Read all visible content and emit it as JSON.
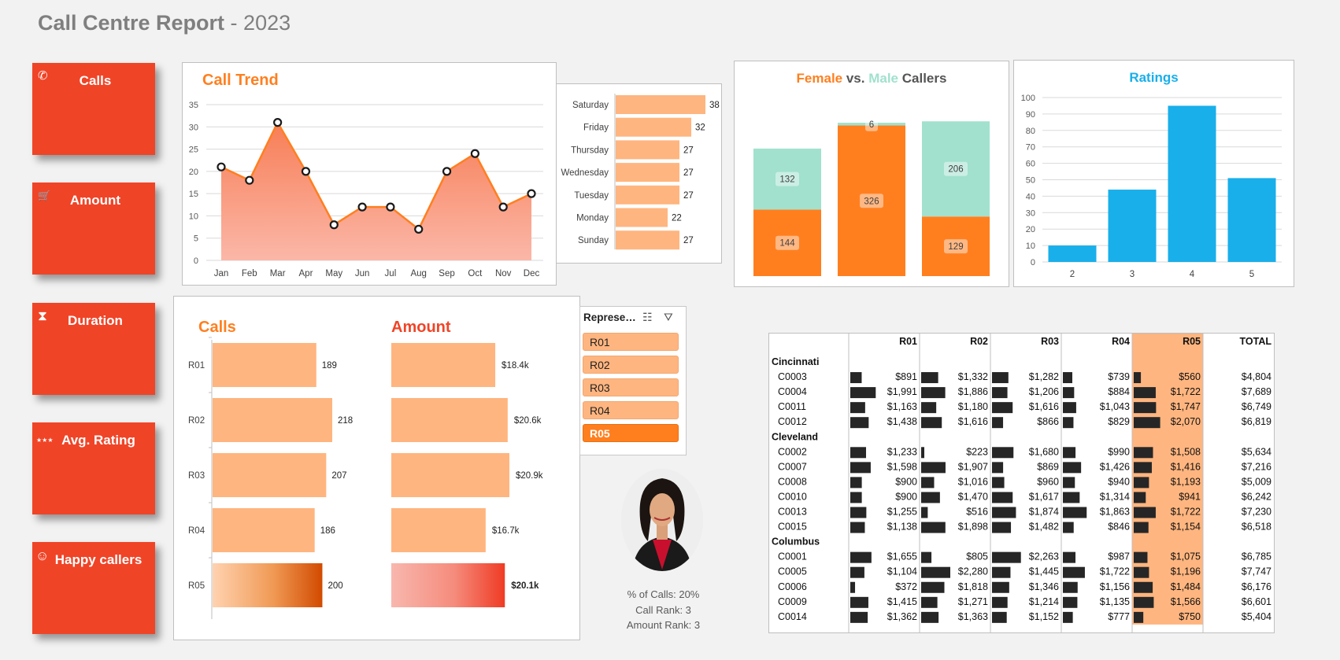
{
  "title": {
    "main": "Call Centre Report",
    "sep": " - ",
    "year": "2023"
  },
  "colors": {
    "kpi": "#f04427",
    "orange": "#ff7f1f",
    "mint": "#a1e1ce",
    "blue": "#19afea",
    "light_orange": "#ffb57f",
    "title_grey": "#7f7f7f"
  },
  "kpis": [
    {
      "label": "Calls",
      "icon": "phone-icon",
      "glyph": "✆"
    },
    {
      "label": "Amount",
      "icon": "cart-icon",
      "glyph": "🛒"
    },
    {
      "label": "Duration",
      "icon": "hourglass-icon",
      "glyph": "⧗"
    },
    {
      "label": "Avg. Rating",
      "icon": "stars-icon",
      "glyph": "★★★"
    },
    {
      "label": "Happy callers",
      "icon": "smiley-icon",
      "glyph": "☺"
    }
  ],
  "call_trend": {
    "title": "Call Trend"
  },
  "gender": {
    "title_female": "Female",
    "title_vs": " vs. ",
    "title_male": "Male",
    "title_callers": " Callers"
  },
  "ratings": {
    "title": "Ratings"
  },
  "rep_panel": {
    "calls_title": "Calls",
    "amount_title": "Amount"
  },
  "slicer": {
    "header": "Represe…",
    "multiselect_icon": "multi-select-icon",
    "clear_filter_icon": "clear-filter-icon",
    "items": [
      {
        "label": "R01",
        "selected": false
      },
      {
        "label": "R02",
        "selected": false
      },
      {
        "label": "R03",
        "selected": false
      },
      {
        "label": "R04",
        "selected": false
      },
      {
        "label": "R05",
        "selected": true
      }
    ]
  },
  "rep_stats": {
    "pct_calls": "% of Calls: 20%",
    "call_rank": "Call Rank: 3",
    "amount_rank": "Amount Rank: 3"
  },
  "chart_data": [
    {
      "type": "area",
      "title": "Call Trend",
      "x": [
        "Jan",
        "Feb",
        "Mar",
        "Apr",
        "May",
        "Jun",
        "Jul",
        "Aug",
        "Sep",
        "Oct",
        "Nov",
        "Dec"
      ],
      "y": [
        21,
        18,
        31,
        20,
        8,
        12,
        12,
        7,
        20,
        24,
        12,
        15
      ],
      "ylim": [
        0,
        35
      ],
      "yticks": [
        "0",
        "5",
        "10",
        "15",
        "20",
        "25",
        "30",
        "35"
      ],
      "grid": true
    },
    {
      "type": "bar",
      "orientation": "horizontal",
      "categories": [
        "Saturday",
        "Friday",
        "Thursday",
        "Wednesday",
        "Tuesday",
        "Monday",
        "Sunday"
      ],
      "values": [
        38,
        32,
        27,
        27,
        27,
        22,
        27
      ],
      "data_labels": true
    },
    {
      "type": "bar",
      "stacked": true,
      "title": "Female vs. Male Callers",
      "series": [
        {
          "name": "Female",
          "values": [
            144,
            326,
            129
          ]
        },
        {
          "name": "Male",
          "values": [
            132,
            6,
            206
          ]
        }
      ],
      "data_labels": true
    },
    {
      "type": "bar",
      "title": "Ratings",
      "categories": [
        "2",
        "3",
        "4",
        "5"
      ],
      "values": [
        10,
        44,
        95,
        51
      ],
      "ylim": [
        0,
        100
      ],
      "yticks": [
        "0",
        "10",
        "20",
        "30",
        "40",
        "50",
        "60",
        "70",
        "80",
        "90",
        "100"
      ],
      "grid": true
    },
    {
      "type": "bar",
      "orientation": "horizontal",
      "title": "Calls",
      "categories": [
        "R01",
        "R02",
        "R03",
        "R04",
        "R05"
      ],
      "values": [
        189,
        218,
        207,
        186,
        200
      ],
      "labels": [
        "189",
        "218",
        "207",
        "186",
        "200"
      ]
    },
    {
      "type": "bar",
      "orientation": "horizontal",
      "title": "Amount",
      "categories": [
        "R01",
        "R02",
        "R03",
        "R04",
        "R05"
      ],
      "values": [
        18.4,
        20.6,
        20.9,
        16.7,
        20.1
      ],
      "labels": [
        "$18.4k",
        "$20.6k",
        "$20.9k",
        "$16.7k",
        "$20.1k"
      ]
    },
    {
      "type": "table",
      "columns": [
        "R01",
        "R02",
        "R03",
        "R04",
        "R05",
        "TOTAL"
      ],
      "highlight_column": "R05",
      "groups": [
        {
          "name": "Cincinnati",
          "rows": [
            {
              "id": "C0003",
              "values": [
                891,
                1332,
                1282,
                739,
                560
              ],
              "labels": [
                "$891",
                "$1,332",
                "$1,282",
                "$739",
                "$560"
              ],
              "total": "$4,804"
            },
            {
              "id": "C0004",
              "values": [
                1991,
                1886,
                1206,
                884,
                1722
              ],
              "labels": [
                "$1,991",
                "$1,886",
                "$1,206",
                "$884",
                "$1,722"
              ],
              "total": "$7,689"
            },
            {
              "id": "C0011",
              "values": [
                1163,
                1180,
                1616,
                1043,
                1747
              ],
              "labels": [
                "$1,163",
                "$1,180",
                "$1,616",
                "$1,043",
                "$1,747"
              ],
              "total": "$6,749"
            },
            {
              "id": "C0012",
              "values": [
                1438,
                1616,
                866,
                829,
                2070
              ],
              "labels": [
                "$1,438",
                "$1,616",
                "$866",
                "$829",
                "$2,070"
              ],
              "total": "$6,819"
            }
          ]
        },
        {
          "name": "Cleveland",
          "rows": [
            {
              "id": "C0002",
              "values": [
                1233,
                223,
                1680,
                990,
                1508
              ],
              "labels": [
                "$1,233",
                "$223",
                "$1,680",
                "$990",
                "$1,508"
              ],
              "total": "$5,634"
            },
            {
              "id": "C0007",
              "values": [
                1598,
                1907,
                869,
                1426,
                1416
              ],
              "labels": [
                "$1,598",
                "$1,907",
                "$869",
                "$1,426",
                "$1,416"
              ],
              "total": "$7,216"
            },
            {
              "id": "C0008",
              "values": [
                900,
                1016,
                960,
                940,
                1193
              ],
              "labels": [
                "$900",
                "$1,016",
                "$960",
                "$940",
                "$1,193"
              ],
              "total": "$5,009"
            },
            {
              "id": "C0010",
              "values": [
                900,
                1470,
                1617,
                1314,
                941
              ],
              "labels": [
                "$900",
                "$1,470",
                "$1,617",
                "$1,314",
                "$941"
              ],
              "total": "$6,242"
            },
            {
              "id": "C0013",
              "values": [
                1255,
                516,
                1874,
                1863,
                1722
              ],
              "labels": [
                "$1,255",
                "$516",
                "$1,874",
                "$1,863",
                "$1,722"
              ],
              "total": "$7,230"
            },
            {
              "id": "C0015",
              "values": [
                1138,
                1898,
                1482,
                846,
                1154
              ],
              "labels": [
                "$1,138",
                "$1,898",
                "$1,482",
                "$846",
                "$1,154"
              ],
              "total": "$6,518"
            }
          ]
        },
        {
          "name": "Columbus",
          "rows": [
            {
              "id": "C0001",
              "values": [
                1655,
                805,
                2263,
                987,
                1075
              ],
              "labels": [
                "$1,655",
                "$805",
                "$2,263",
                "$987",
                "$1,075"
              ],
              "total": "$6,785"
            },
            {
              "id": "C0005",
              "values": [
                1104,
                2280,
                1445,
                1722,
                1196
              ],
              "labels": [
                "$1,104",
                "$2,280",
                "$1,445",
                "$1,722",
                "$1,196"
              ],
              "total": "$7,747"
            },
            {
              "id": "C0006",
              "values": [
                372,
                1818,
                1346,
                1156,
                1484
              ],
              "labels": [
                "$372",
                "$1,818",
                "$1,346",
                "$1,156",
                "$1,484"
              ],
              "total": "$6,176"
            },
            {
              "id": "C0009",
              "values": [
                1415,
                1271,
                1214,
                1135,
                1566
              ],
              "labels": [
                "$1,415",
                "$1,271",
                "$1,214",
                "$1,135",
                "$1,566"
              ],
              "total": "$6,601"
            },
            {
              "id": "C0014",
              "values": [
                1362,
                1363,
                1152,
                777,
                750
              ],
              "labels": [
                "$1,362",
                "$1,363",
                "$1,152",
                "$777",
                "$750"
              ],
              "total": "$5,404"
            }
          ]
        }
      ]
    }
  ]
}
